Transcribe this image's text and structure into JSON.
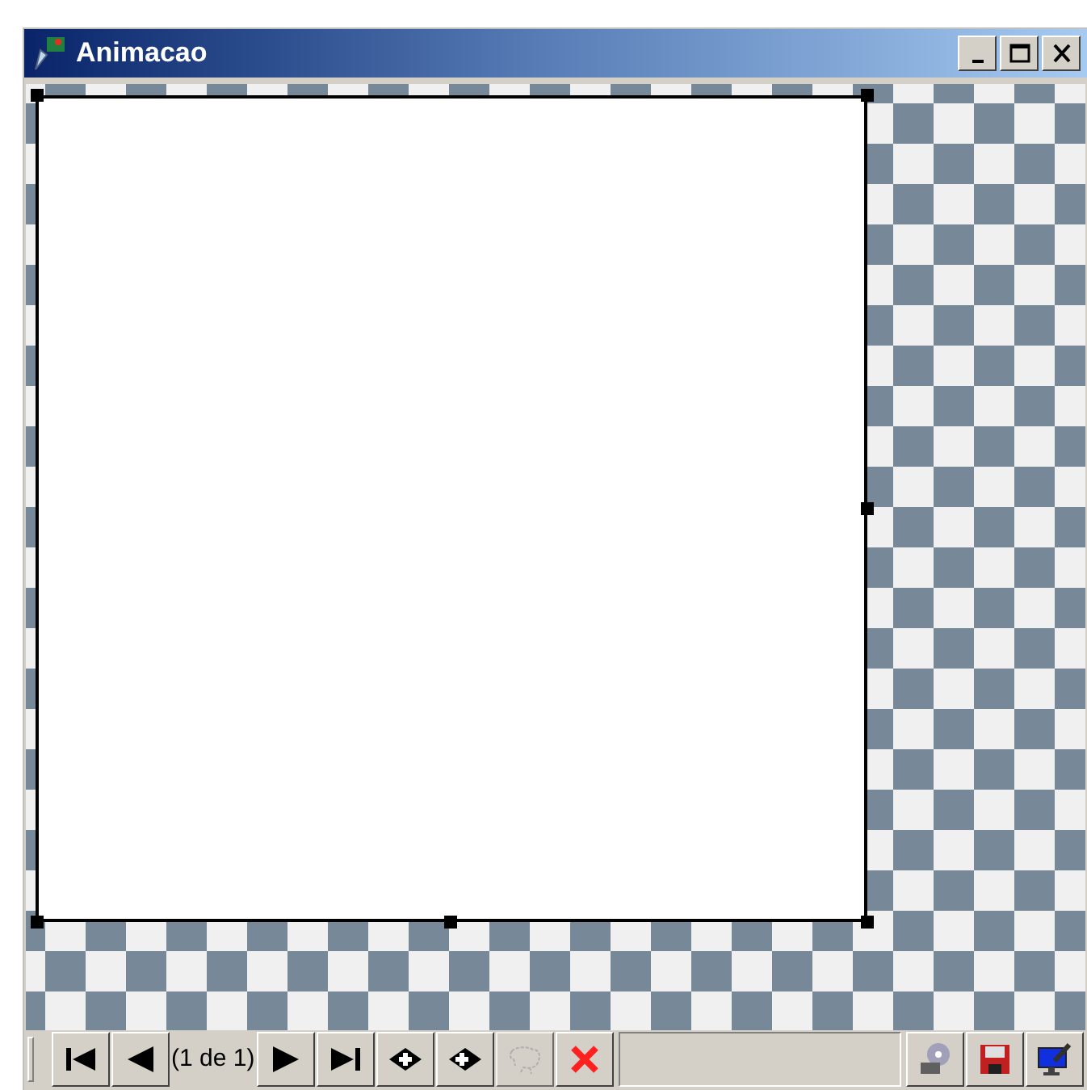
{
  "window": {
    "title": "Animacao",
    "controls": [
      {
        "kind": "minimize"
      },
      {
        "kind": "maximize"
      },
      {
        "kind": "close"
      }
    ]
  },
  "toolbar": {
    "nav_buttons": [
      {
        "kind": "first",
        "disabled": false
      },
      {
        "kind": "prev",
        "disabled": false
      }
    ],
    "frame_counter": "(1 de 1)",
    "edit_buttons": [
      {
        "kind": "next",
        "disabled": false
      },
      {
        "kind": "last",
        "disabled": false
      },
      {
        "kind": "insert_before",
        "disabled": false
      },
      {
        "kind": "insert_after",
        "disabled": false
      },
      {
        "kind": "sheep",
        "disabled": true
      },
      {
        "kind": "delete",
        "disabled": false
      }
    ],
    "right_buttons": [
      {
        "kind": "film",
        "disabled": false
      },
      {
        "kind": "save",
        "disabled": false
      },
      {
        "kind": "monitor",
        "disabled": false
      }
    ]
  }
}
